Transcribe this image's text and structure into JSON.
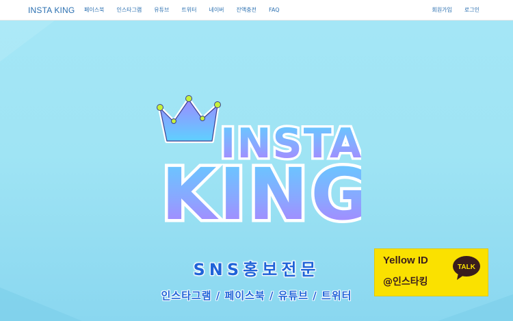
{
  "nav": {
    "brand": "INSTA KING",
    "left_links": [
      "페이스북",
      "인스타그램",
      "유튜브",
      "트위터",
      "네이버",
      "잔액충전",
      "FAQ"
    ],
    "right_links": [
      "회원가입",
      "로그인"
    ]
  },
  "hero": {
    "logo_line1": "INSTA",
    "logo_line2": "KING",
    "headline": "SNS홍보전문",
    "subline": "인스타그램 / 페이스북 / 유튜브 / 트위터"
  },
  "kakao": {
    "title": "Yellow ID",
    "id": "@인스타킹",
    "talk": "TALK"
  },
  "colors": {
    "nav_link": "#2a6fb0",
    "hero_bg": "#9fe3f4",
    "headline": "#1f63d8",
    "kakao_yellow": "#fae100",
    "kakao_brown": "#3a1d1d"
  },
  "icons": [
    "crown-icon",
    "kakao-talk-icon"
  ]
}
